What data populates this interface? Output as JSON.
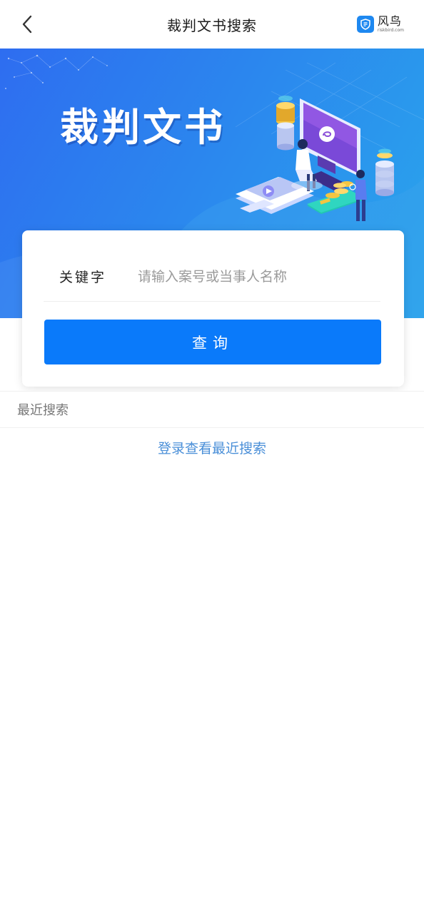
{
  "header": {
    "title": "裁判文书搜索",
    "back_icon": "chevron-left-icon",
    "brand_name": "风鸟",
    "brand_url": "riskbird.com",
    "brand_color": "#1e88f0"
  },
  "banner": {
    "title": "裁判文书",
    "colors": {
      "from": "#2e6df0",
      "to": "#2aa6ec"
    }
  },
  "search": {
    "keyword_label": "关键字",
    "placeholder": "请输入案号或当事人名称",
    "value": "",
    "button_label": "查询",
    "button_color": "#0a7afa"
  },
  "recent": {
    "title": "最近搜索",
    "login_link": "登录查看最近搜索",
    "link_color": "#4a8fd8"
  }
}
